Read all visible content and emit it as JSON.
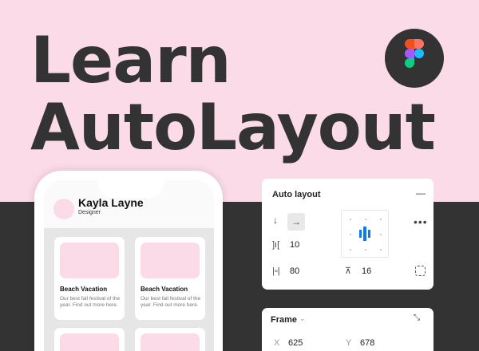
{
  "title": {
    "line1": "Learn",
    "line2": "AutoLayout"
  },
  "logo": {
    "name": "figma-logo",
    "colors": [
      "#f24e1e",
      "#ff7262",
      "#a259ff",
      "#1abcfe",
      "#0acf83"
    ]
  },
  "profile": {
    "name": "Kayla Layne",
    "role": "Designer"
  },
  "cards": [
    {
      "title": "Beach Vacation",
      "desc": "Our best fall festival of the year. Find out more here."
    },
    {
      "title": "Beach Vacation",
      "desc": "Our best fall festival of the year. Find out more here."
    }
  ],
  "auto_layout": {
    "title": "Auto layout",
    "spacing": "10",
    "horizontal_padding": "80",
    "vertical_padding": "16",
    "accent": "#0d7ae5"
  },
  "frame": {
    "title": "Frame",
    "x_label": "X",
    "x": "625",
    "y_label": "Y",
    "y": "678"
  }
}
